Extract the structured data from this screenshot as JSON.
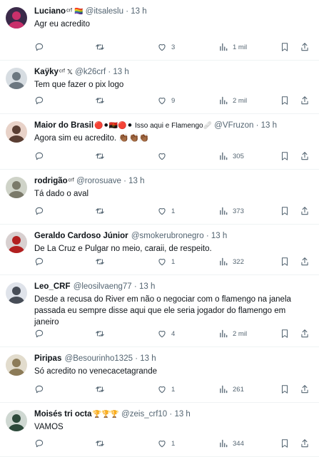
{
  "colors": {
    "text": "#0f1419",
    "muted": "#536471",
    "divider": "#eff3f4"
  },
  "icons": [
    "reply-icon",
    "retweet-icon",
    "like-icon",
    "views-icon",
    "bookmark-icon",
    "share-icon"
  ],
  "tweets": [
    {
      "name": "Luciano",
      "name_badge": "ᶜʳᶠ 🏳️‍🌈",
      "handle": "@itsaleslu",
      "sep": "·",
      "time": "13 h",
      "text": "Agr eu acredito",
      "replies": "",
      "retweets": "",
      "likes": "3",
      "views": "1 mil"
    },
    {
      "name": "Kaÿky",
      "name_badge": "ᶜʳᶠ 𝕏",
      "handle": "@k26crf",
      "sep": "·",
      "time": "13 h",
      "text": "Tem que fazer o pix logo",
      "replies": "",
      "retweets": "",
      "likes": "9",
      "views": "2 mil"
    },
    {
      "name": "Maior do Brasil",
      "name_badge": "🔴⚫🇦🇴🔴⚫ Isso aqui e Flamengo🩹",
      "handle": "@VFruzon",
      "sep": "·",
      "time": "13 h",
      "text": "Agora sim eu acredito. 👏🏾👏🏾👏🏾",
      "replies": "",
      "retweets": "",
      "likes": "",
      "views": "305"
    },
    {
      "name": "rodrigão",
      "name_badge": "ᶜʳᶠ",
      "handle": "@rorosuave",
      "sep": "·",
      "time": "13 h",
      "text": "Tá dado o aval",
      "replies": "",
      "retweets": "",
      "likes": "1",
      "views": "373"
    },
    {
      "name": "Geraldo Cardoso Júnior",
      "name_badge": "",
      "handle": "@smokerubronegro",
      "sep": "·",
      "time": "13 h",
      "text": "De La Cruz e Pulgar no meio, caraii, de respeito.",
      "replies": "",
      "retweets": "",
      "likes": "1",
      "views": "322"
    },
    {
      "name": "Leo_CRF",
      "name_badge": "",
      "handle": "@leosilvaeng77",
      "sep": "·",
      "time": "13 h",
      "text": "Desde a recusa do River em não o negociar com o flamengo na janela passada eu sempre disse aqui que ele seria jogador do flamengo em janeiro",
      "replies": "",
      "retweets": "",
      "likes": "4",
      "views": "2 mil"
    },
    {
      "name": "Piripas",
      "name_badge": "",
      "handle": "@Besourinho1325",
      "sep": "·",
      "time": "13 h",
      "text": "Só acredito no venecacetagrande",
      "replies": "",
      "retweets": "",
      "likes": "1",
      "views": "261"
    },
    {
      "name": "Moisés tri octa",
      "name_badge": "🏆🏆🏆",
      "handle": "@zeis_crf10",
      "sep": "·",
      "time": "13 h",
      "text": "VAMOS",
      "replies": "",
      "retweets": "",
      "likes": "1",
      "views": "344"
    }
  ]
}
